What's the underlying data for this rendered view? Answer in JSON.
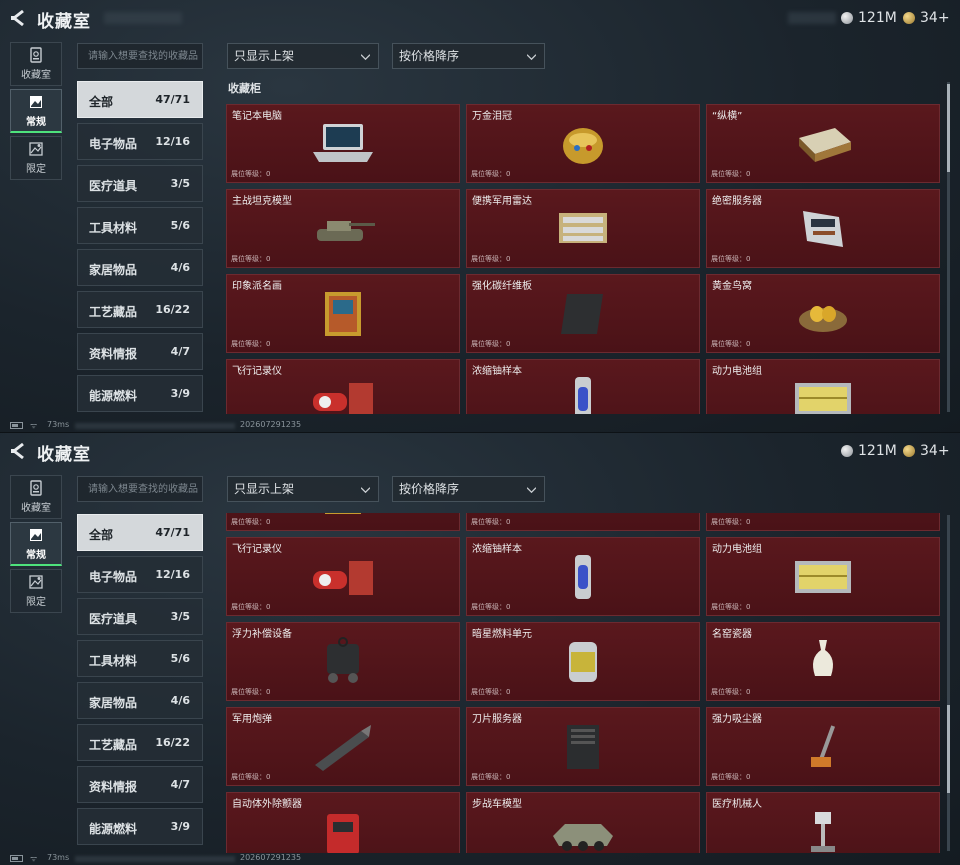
{
  "header": {
    "title": "收藏室"
  },
  "currency": [
    {
      "icon": "silver-coin-icon",
      "value": "121M"
    },
    {
      "icon": "gold-coin-icon",
      "value": "34+"
    }
  ],
  "sidebar": {
    "items": [
      {
        "label": "收藏室",
        "icon": "collection-room-icon",
        "active": false
      },
      {
        "label": "常规",
        "icon": "regular-icon",
        "active": true
      },
      {
        "label": "限定",
        "icon": "limited-icon",
        "active": false
      }
    ]
  },
  "search": {
    "placeholder": "请输入想要查找的收藏品"
  },
  "filters": {
    "display": {
      "value": "只显示上架"
    },
    "sort": {
      "value": "按价格降序"
    }
  },
  "categories": [
    {
      "name": "全部",
      "count": "47/71",
      "active": true
    },
    {
      "name": "电子物品",
      "count": "12/16"
    },
    {
      "name": "医疗道具",
      "count": "3/5"
    },
    {
      "name": "工具材料",
      "count": "5/6"
    },
    {
      "name": "家居物品",
      "count": "4/6"
    },
    {
      "name": "工艺藏品",
      "count": "16/22"
    },
    {
      "name": "资料情报",
      "count": "4/7"
    },
    {
      "name": "能源燃料",
      "count": "3/9"
    }
  ],
  "shelf": {
    "label": "收藏柜"
  },
  "level_label": "展位等级：0",
  "items": [
    {
      "name": "笔记本电脑",
      "icon": "laptop-icon"
    },
    {
      "name": "万金泪冠",
      "icon": "jeweled-egg-icon"
    },
    {
      "name": "“纵横”",
      "icon": "chessboard-icon"
    },
    {
      "name": "主战坦克模型",
      "icon": "tank-model-icon"
    },
    {
      "name": "便携军用雷达",
      "icon": "radar-icon"
    },
    {
      "name": "绝密服务器",
      "icon": "server-icon"
    },
    {
      "name": "印象派名画",
      "icon": "painting-icon"
    },
    {
      "name": "强化碳纤维板",
      "icon": "carbon-plate-icon"
    },
    {
      "name": "黄金鸟窝",
      "icon": "golden-nest-icon"
    },
    {
      "name": "飞行记录仪",
      "icon": "flight-recorder-icon"
    },
    {
      "name": "浓缩铀样本",
      "icon": "uranium-sample-icon"
    },
    {
      "name": "动力电池组",
      "icon": "battery-pack-icon"
    },
    {
      "name": "浮力补偿设备",
      "icon": "buoyancy-device-icon"
    },
    {
      "name": "暗星燃料单元",
      "icon": "fuel-cell-icon"
    },
    {
      "name": "名窑瓷器",
      "icon": "porcelain-vase-icon"
    },
    {
      "name": "军用炮弹",
      "icon": "artillery-shell-icon"
    },
    {
      "name": "刀片服务器",
      "icon": "blade-server-icon"
    },
    {
      "name": "强力吸尘器",
      "icon": "vacuum-cleaner-icon"
    },
    {
      "name": "自动体外除颤器",
      "icon": "defibrillator-icon"
    },
    {
      "name": "步战车模型",
      "icon": "ifv-model-icon"
    },
    {
      "name": "医疗机械人",
      "icon": "medical-robot-icon"
    }
  ],
  "status_bar": {
    "latency": "73ms",
    "timestamp": "202607291235"
  }
}
